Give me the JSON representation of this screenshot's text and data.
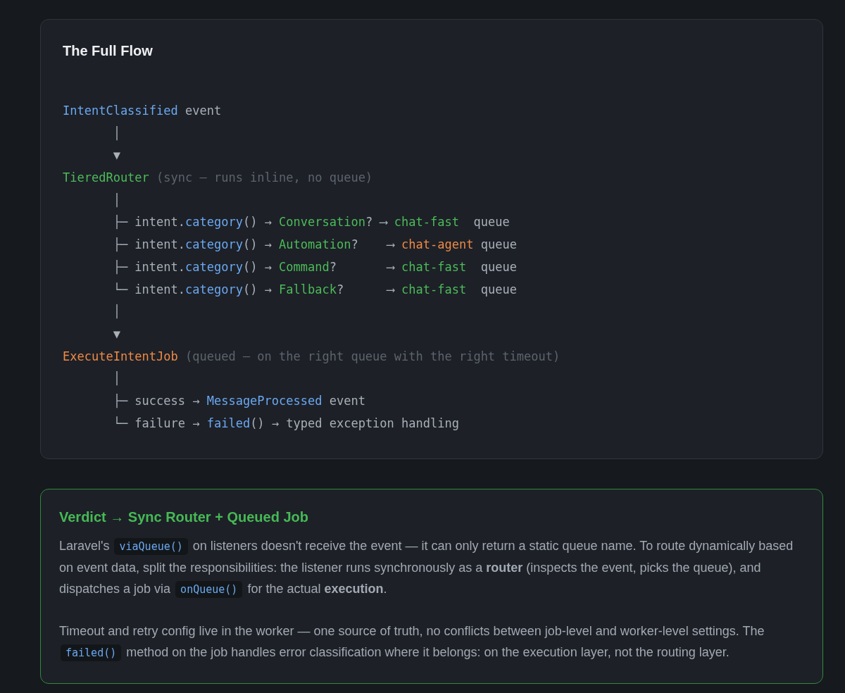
{
  "flow_card": {
    "title": "The Full Flow",
    "code_lines": [
      {
        "segments": [
          {
            "kind": "blue",
            "text": "IntentClassified"
          },
          {
            "kind": "plain",
            "text": " event"
          }
        ]
      },
      {
        "segments": [
          {
            "kind": "plain",
            "text": "       │"
          }
        ]
      },
      {
        "segments": [
          {
            "kind": "plain",
            "text": "       ▼"
          }
        ]
      },
      {
        "segments": [
          {
            "kind": "green",
            "text": "TieredRouter"
          },
          {
            "kind": "dim",
            "text": " (sync — runs inline, no queue)"
          }
        ]
      },
      {
        "segments": [
          {
            "kind": "plain",
            "text": "       │"
          }
        ]
      },
      {
        "segments": [
          {
            "kind": "plain",
            "text": "       ├─ intent."
          },
          {
            "kind": "blue",
            "text": "category"
          },
          {
            "kind": "plain",
            "text": "() → "
          },
          {
            "kind": "green",
            "text": "Conversation"
          },
          {
            "kind": "plain",
            "text": "? ⟶ "
          },
          {
            "kind": "green",
            "text": "chat-fast"
          },
          {
            "kind": "plain",
            "text": "  queue"
          }
        ]
      },
      {
        "segments": [
          {
            "kind": "plain",
            "text": "       ├─ intent."
          },
          {
            "kind": "blue",
            "text": "category"
          },
          {
            "kind": "plain",
            "text": "() → "
          },
          {
            "kind": "green",
            "text": "Automation"
          },
          {
            "kind": "plain",
            "text": "?    ⟶ "
          },
          {
            "kind": "orange",
            "text": "chat-agent"
          },
          {
            "kind": "plain",
            "text": " queue"
          }
        ]
      },
      {
        "segments": [
          {
            "kind": "plain",
            "text": "       ├─ intent."
          },
          {
            "kind": "blue",
            "text": "category"
          },
          {
            "kind": "plain",
            "text": "() → "
          },
          {
            "kind": "green",
            "text": "Command"
          },
          {
            "kind": "plain",
            "text": "?       ⟶ "
          },
          {
            "kind": "green",
            "text": "chat-fast"
          },
          {
            "kind": "plain",
            "text": "  queue"
          }
        ]
      },
      {
        "segments": [
          {
            "kind": "plain",
            "text": "       └─ intent."
          },
          {
            "kind": "blue",
            "text": "category"
          },
          {
            "kind": "plain",
            "text": "() → "
          },
          {
            "kind": "green",
            "text": "Fallback"
          },
          {
            "kind": "plain",
            "text": "?      ⟶ "
          },
          {
            "kind": "green",
            "text": "chat-fast"
          },
          {
            "kind": "plain",
            "text": "  queue"
          }
        ]
      },
      {
        "segments": [
          {
            "kind": "plain",
            "text": "       │"
          }
        ]
      },
      {
        "segments": [
          {
            "kind": "plain",
            "text": "       ▼"
          }
        ]
      },
      {
        "segments": [
          {
            "kind": "orange",
            "text": "ExecuteIntentJob"
          },
          {
            "kind": "dim",
            "text": " (queued — on the right queue with the right timeout)"
          }
        ]
      },
      {
        "segments": [
          {
            "kind": "plain",
            "text": "       │"
          }
        ]
      },
      {
        "segments": [
          {
            "kind": "plain",
            "text": "       ├─ success → "
          },
          {
            "kind": "blue",
            "text": "MessageProcessed"
          },
          {
            "kind": "plain",
            "text": " event"
          }
        ]
      },
      {
        "segments": [
          {
            "kind": "plain",
            "text": "       └─ failure → "
          },
          {
            "kind": "blue",
            "text": "failed"
          },
          {
            "kind": "plain",
            "text": "() → typed exception handling"
          }
        ]
      }
    ]
  },
  "verdict_card": {
    "title": "Verdict → Sync Router + Queued Job",
    "paragraphs": [
      {
        "segments": [
          {
            "kind": "text",
            "text": "Laravel's "
          },
          {
            "kind": "code",
            "text": "viaQueue()"
          },
          {
            "kind": "text",
            "text": " on listeners doesn't receive the event — it can only return a static queue name. To route dynamically based on event data, split the responsibilities: the listener runs synchronously as a **router** (inspects the event, picks the queue), and dispatches a job via "
          },
          {
            "kind": "code",
            "text": "onQueue()"
          },
          {
            "kind": "text",
            "text": " for the actual **execution**."
          }
        ]
      },
      {
        "segments": [
          {
            "kind": "text",
            "text": "Timeout and retry config live in the worker — one source of truth, no conflicts between job-level and worker-level settings. The "
          },
          {
            "kind": "code",
            "text": "failed()"
          },
          {
            "kind": "text",
            "text": " method on the job handles error classification where it belongs: on the execution layer, not the routing layer."
          }
        ]
      }
    ]
  }
}
